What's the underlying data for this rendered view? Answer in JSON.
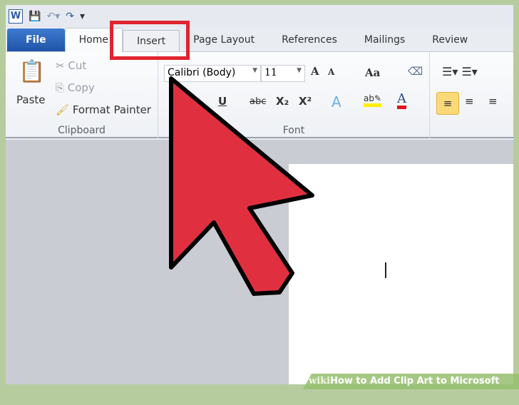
{
  "qat": {
    "word_icon": "W"
  },
  "tabs": [
    {
      "label": "File"
    },
    {
      "label": "Home"
    },
    {
      "label": "Insert"
    },
    {
      "label": "Page Layout"
    },
    {
      "label": "References"
    },
    {
      "label": "Mailings"
    },
    {
      "label": "Review"
    }
  ],
  "clipboard": {
    "paste": "Paste",
    "cut": "Cut",
    "copy": "Copy",
    "format_painter": "Format Painter",
    "label": "Clipboard"
  },
  "font": {
    "family": "Calibri (Body)",
    "size": "11",
    "label": "Font",
    "grow": "A",
    "shrink": "A",
    "case": "Aa",
    "underline": "U",
    "strike": "abc",
    "sub": "X₂",
    "sup": "X²"
  },
  "annotation": {
    "highlight_color": "#e0242f",
    "arrow_color": "#e03040",
    "highlighted_tab": "Insert"
  },
  "watermark": {
    "wiki": "wiki",
    "title": "How to Add Clip Art to Microsoft Word"
  }
}
